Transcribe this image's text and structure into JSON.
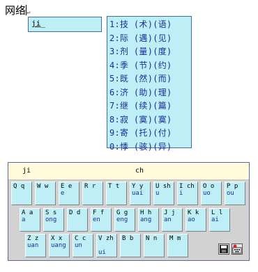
{
  "document": {
    "text": "网络"
  },
  "ime": {
    "input": "ji",
    "candidates": [
      "1:技 (术)(语)",
      "2:际 (遇)(见)",
      "3:剂 (量)(度)",
      "4:季 (节)(约)",
      "5:既 (然)(而)",
      "6:济 (助)(理)",
      "7:继 (续)(篇)",
      "8:寂 (寞)(寞)",
      "9:寄 (托)(付)",
      "0:悸 (骇)(异)"
    ]
  },
  "keyboard": {
    "left_label": "ji",
    "center_label": "ch",
    "rows": [
      [
        {
          "key": "Q q",
          "sub": ""
        },
        {
          "key": "W w",
          "sub": ""
        },
        {
          "key": "E e",
          "sub": "e"
        },
        {
          "key": "R r",
          "sub": ""
        },
        {
          "key": "T t",
          "sub": ""
        },
        {
          "key": "Y y",
          "sub": "uai"
        },
        {
          "key": "U sh",
          "sub": "u"
        },
        {
          "key": "I ch",
          "sub": "i"
        },
        {
          "key": "O o",
          "sub": "uo"
        },
        {
          "key": "P p",
          "sub": "ou"
        }
      ],
      [
        {
          "key": "A a",
          "sub": "a"
        },
        {
          "key": "S s",
          "sub": "ong"
        },
        {
          "key": "D d",
          "sub": ""
        },
        {
          "key": "F f",
          "sub": "en"
        },
        {
          "key": "G g",
          "sub": "eng"
        },
        {
          "key": "H h",
          "sub": "ang"
        },
        {
          "key": "J j",
          "sub": "an"
        },
        {
          "key": "K k",
          "sub": "ao"
        },
        {
          "key": "L l",
          "sub": "ai"
        }
      ],
      [
        {
          "key": "Z z",
          "sub": "uan"
        },
        {
          "key": "X x",
          "sub": "uang"
        },
        {
          "key": "C c",
          "sub": "un"
        },
        {
          "key": "V zh",
          "sub": "",
          "sub2": "ui"
        },
        {
          "key": "B b",
          "sub": ""
        },
        {
          "key": "N n",
          "sub": ""
        },
        {
          "key": "M m",
          "sub": ""
        }
      ]
    ],
    "tools": [
      "floppy-disk-icon",
      "keyboard-settings-icon"
    ]
  }
}
